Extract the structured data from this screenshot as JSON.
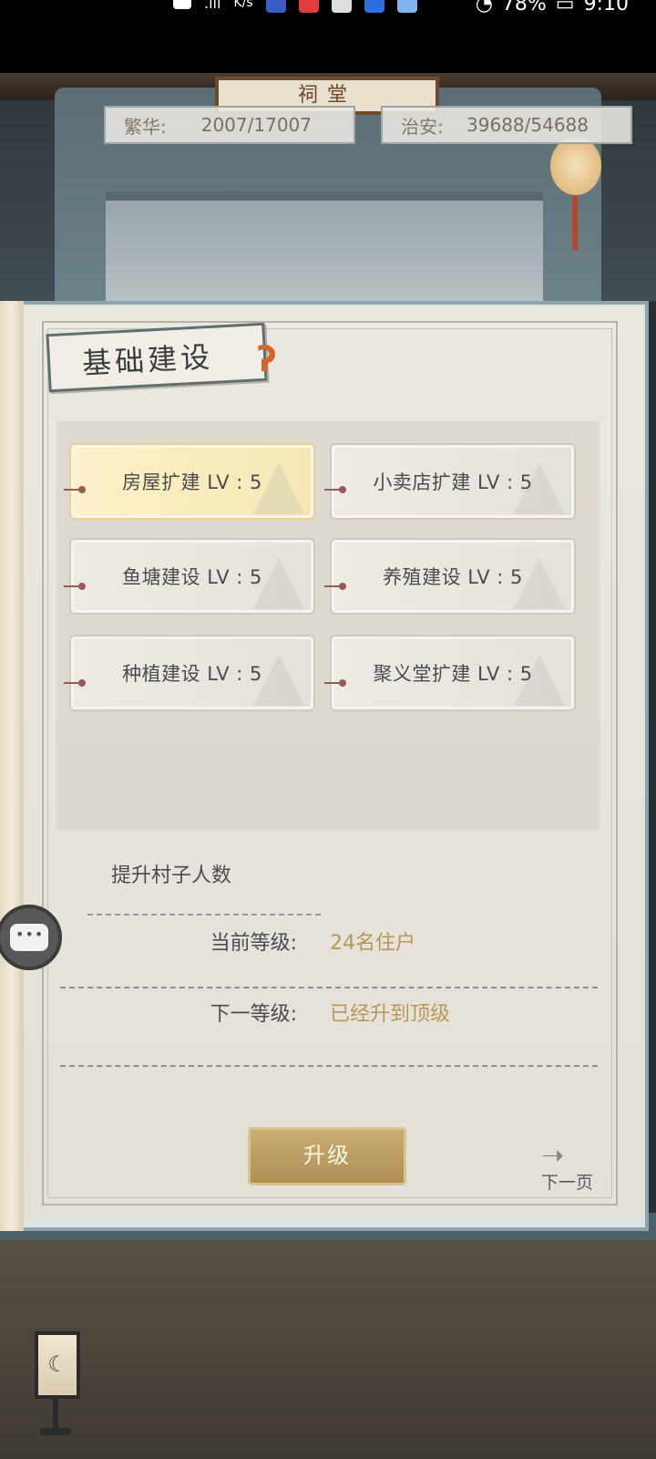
{
  "status_bar": {
    "network_speed": "K/s",
    "battery_text": "78%",
    "time": "9:10"
  },
  "scene": {
    "plaque_text": "祠堂"
  },
  "stats": {
    "prosperity": {
      "label": "繁华:",
      "value": "2007/17007"
    },
    "security": {
      "label": "治安:",
      "value": "39688/54688"
    }
  },
  "section": {
    "title": "基础建设"
  },
  "options": [
    {
      "label": "房屋扩建 LV : 5",
      "selected": true
    },
    {
      "label": "小卖店扩建 LV : 5",
      "selected": false
    },
    {
      "label": "鱼塘建设 LV : 5",
      "selected": false
    },
    {
      "label": "养殖建设 LV : 5",
      "selected": false
    },
    {
      "label": "种植建设 LV : 5",
      "selected": false
    },
    {
      "label": "聚义堂扩建 LV : 5",
      "selected": false
    }
  ],
  "detail": {
    "description": "提升村子人数",
    "current_level_label": "当前等级:",
    "current_level_value": "24名住户",
    "next_level_label": "下一等级:",
    "next_level_value": "已经升到顶级"
  },
  "actions": {
    "upgrade_label": "升级",
    "next_page_label": "下一页"
  },
  "floor": {
    "lamp_symbol": "☾"
  },
  "colors": {
    "accent_gold": "#b49a56",
    "selected_bg": "#fcf1c9",
    "button_gold": "#c9ad72"
  }
}
